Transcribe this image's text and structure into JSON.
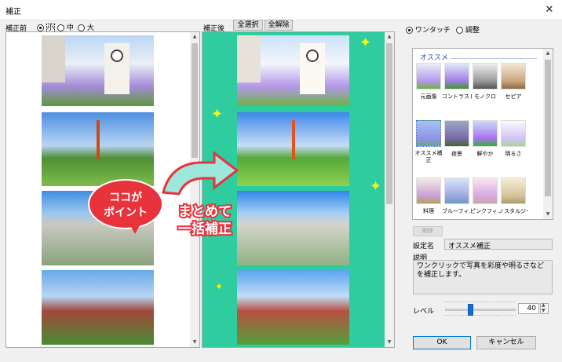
{
  "window": {
    "title": "補正",
    "close_label": "✕"
  },
  "before": {
    "label": "補正前",
    "sizes": [
      {
        "label": "小",
        "selected": true
      },
      {
        "label": "中",
        "selected": false
      },
      {
        "label": "大",
        "selected": false
      }
    ]
  },
  "after": {
    "label": "補正後",
    "select_all": "全選択",
    "deselect_all": "全解除"
  },
  "callout": {
    "bubble_line1": "ココが",
    "bubble_line2": "ポイント",
    "caption_line1": "まとめて",
    "caption_line2": "一括補正"
  },
  "mode": {
    "options": [
      {
        "label": "ワンタッチ",
        "selected": true
      },
      {
        "label": "調整",
        "selected": false
      }
    ]
  },
  "presets": {
    "section_label": "オススメ",
    "items": [
      {
        "label": "元画像"
      },
      {
        "label": "コントラスト"
      },
      {
        "label": "モノクロ"
      },
      {
        "label": "セピア"
      },
      {
        "label": "オススメ補正"
      },
      {
        "label": "夜景"
      },
      {
        "label": "鮮やか"
      },
      {
        "label": "明るさ"
      },
      {
        "label": "料理"
      },
      {
        "label": "ブルーフィ..."
      },
      {
        "label": "ピンクフィ..."
      },
      {
        "label": "ノスタルジー"
      }
    ],
    "delete_label": "削除",
    "setting_name_label": "設定名",
    "setting_name_value": "オススメ補正",
    "description_label": "説明",
    "description_text": "ワンクリックで写真を彩度や明るさなどを補正します。"
  },
  "level": {
    "label": "レベル",
    "value": "40"
  },
  "footer": {
    "ok": "OK",
    "cancel": "キャンセル"
  },
  "colors": {
    "teal": "#2ecc9e",
    "bubble_red": "#e8323c",
    "sparkle": "#fff400"
  }
}
